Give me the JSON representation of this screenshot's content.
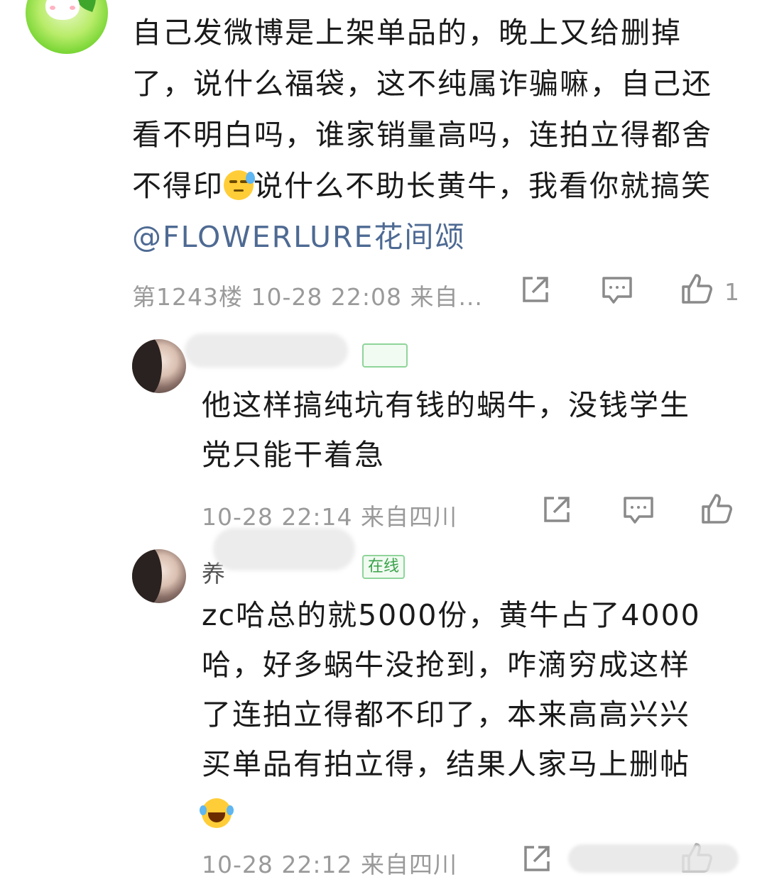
{
  "main_comment": {
    "line1": "自己发微博是上架单品的，晚上又给删掉",
    "line2": "了，说什么福袋，这不纯属诈骗嘛，自己还",
    "line3": "看不明白吗，谁家销量高吗，连拍立得都舍",
    "line4a": "不得印",
    "line4b": "说什么不助长黄牛，我看你就搞笑",
    "mention": "@FLOWERLURE花间颂",
    "emoji": "sweat-face-icon",
    "meta": "第1243楼 10-28 22:08  来自...",
    "like_count": "1"
  },
  "replies": [
    {
      "name": "",
      "badge": "",
      "line1": "他这样搞纯坑有钱的蜗牛，没钱学生",
      "line2": "党只能干着急",
      "meta": "10-28 22:14  来自四川"
    },
    {
      "name": "养",
      "badge": "在线",
      "line1": "zc哈总的就5000份，黄牛占了4000",
      "line2": "哈，好多蜗牛没抢到，咋滴穷成这样",
      "line3": "了连拍立得都不印了，本来高高兴兴",
      "line4": "买单品有拍立得，结果人家马上删帖",
      "emoji": "laughing-tears-icon",
      "meta": "10-28 22:12  来自四川"
    }
  ],
  "colors": {
    "mention": "#4e6a93",
    "meta": "#9a9a9a",
    "badge": "#3aa24a"
  }
}
